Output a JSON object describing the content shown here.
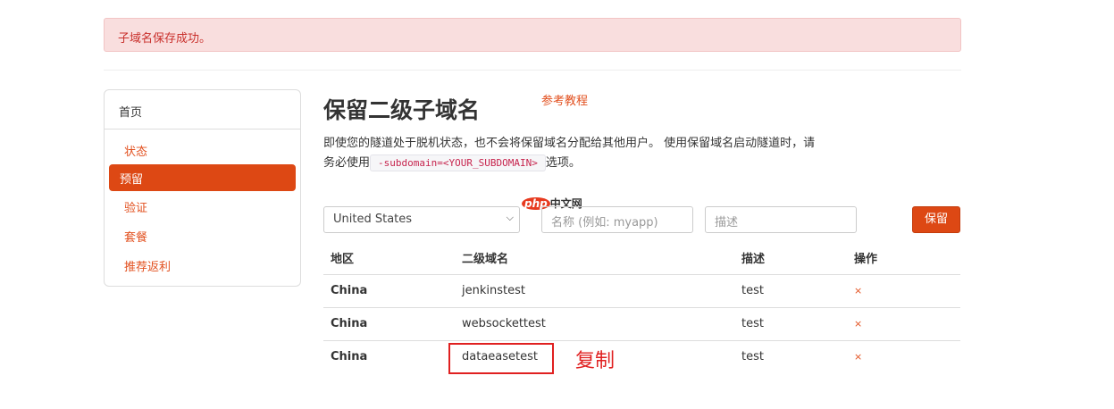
{
  "alert": "子域名保存成功。",
  "sidebar": {
    "home": "首页",
    "items": [
      {
        "label": "状态"
      },
      {
        "label": "预留"
      },
      {
        "label": "验证"
      },
      {
        "label": "套餐"
      },
      {
        "label": "推荐返利"
      }
    ]
  },
  "main": {
    "title": "保留二级子域名",
    "ref_link": "参考教程",
    "desc1": "即使您的隧道处于脱机状态，也不会将保留域名分配给其他用户。 使用保留域名启动隧道时，请务必使用",
    "code": "-subdomain=<YOUR_SUBDOMAIN>",
    "desc2": "选项。"
  },
  "form": {
    "region": "United States",
    "name_placeholder": "名称 (例如: myapp)",
    "desc_placeholder": "描述",
    "save": "保留"
  },
  "watermark": {
    "p": "php",
    "t": "中文网"
  },
  "table": {
    "headers": [
      "地区",
      "二级域名",
      "描述",
      "操作"
    ],
    "rows": [
      {
        "region": "China",
        "sub": "jenkinstest",
        "desc": "test",
        "op": "×"
      },
      {
        "region": "China",
        "sub": "websockettest",
        "desc": "test",
        "op": "×"
      },
      {
        "region": "China",
        "sub": "dataeasetest",
        "desc": "test",
        "op": "×"
      }
    ]
  },
  "annotation": "复制"
}
